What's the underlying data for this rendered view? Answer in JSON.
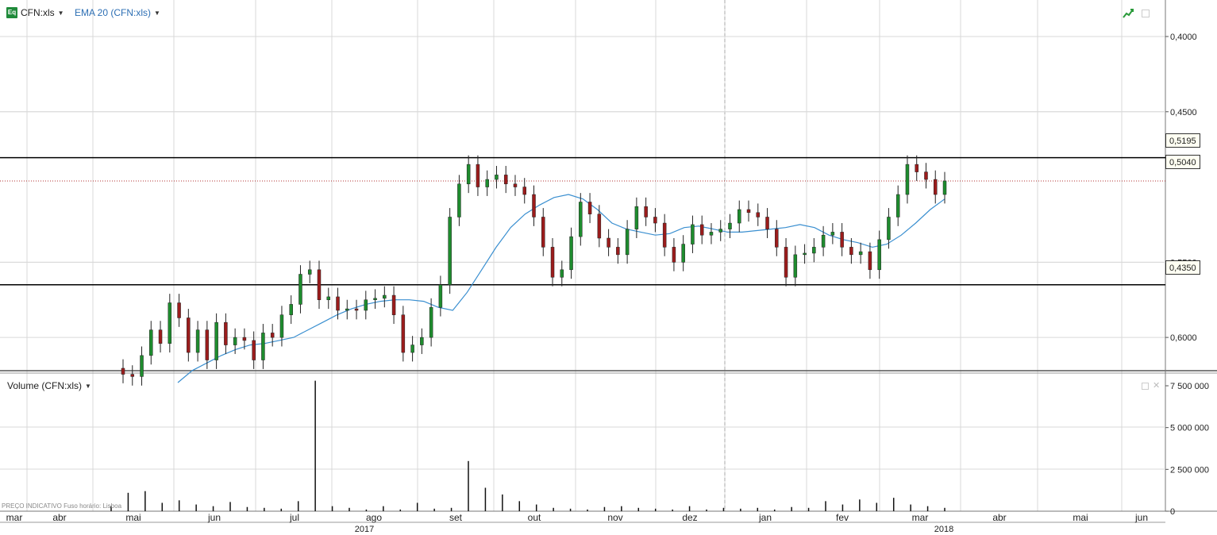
{
  "toolbar": {
    "symbol": "CFN:xls",
    "indicator": "EMA 20 (CFN:xls)"
  },
  "volume_panel": {
    "title": "Volume (CFN:xls)",
    "watermark": "PREÇO INDICATIVO    Fuso horário: Lisboa"
  },
  "price_boxes": {
    "upper": "0,5195",
    "current": "0,5040",
    "lower": "0,4350"
  },
  "colors": {
    "up": "#1e8c2e",
    "down": "#9b1c1c",
    "ema": "#3a8fd0",
    "grid": "#d9d9d9",
    "hline": "#000000",
    "current": "#b03030"
  },
  "chart_data": [
    {
      "type": "candlestick",
      "title": "CFN:xls",
      "y_ticks": [
        "0,4000",
        "0,4500",
        "0,5500",
        "0,6000"
      ],
      "ylim": [
        0.37,
        0.62
      ],
      "x_months": [
        "mar",
        "abr",
        "mai",
        "jun",
        "jul",
        "ago",
        "set",
        "out",
        "nov",
        "dez",
        "jan",
        "fev",
        "mar",
        "abr",
        "mai",
        "jun"
      ],
      "x_years": [
        "2017",
        "2018"
      ],
      "horizontal_lines": [
        0.5195,
        0.435
      ],
      "current_price": 0.504,
      "series": [
        {
          "name": "CFN:xls",
          "close": [
            0.3755,
            0.374,
            0.388,
            0.405,
            0.396,
            0.423,
            0.413,
            0.39,
            0.405,
            0.385,
            0.41,
            0.395,
            0.4,
            0.398,
            0.385,
            0.403,
            0.4,
            0.415,
            0.422,
            0.442,
            0.445,
            0.425,
            0.427,
            0.418,
            0.419,
            0.418,
            0.425,
            0.426,
            0.428,
            0.415,
            0.39,
            0.395,
            0.4,
            0.42,
            0.435,
            0.48,
            0.502,
            0.515,
            0.5,
            0.505,
            0.508,
            0.502,
            0.5,
            0.495,
            0.48,
            0.46,
            0.44,
            0.445,
            0.467,
            0.49,
            0.482,
            0.466,
            0.46,
            0.455,
            0.472,
            0.487,
            0.48,
            0.476,
            0.46,
            0.45,
            0.462,
            0.475,
            0.468,
            0.47,
            0.472,
            0.476,
            0.485,
            0.483,
            0.48,
            0.472,
            0.46,
            0.44,
            0.455,
            0.456,
            0.46,
            0.468,
            0.47,
            0.46,
            0.455,
            0.457,
            0.445,
            0.465,
            0.48,
            0.495,
            0.515,
            0.51,
            0.505,
            0.495,
            0.504
          ]
        },
        {
          "name": "EMA 20 (CFN:xls)",
          "values": [
            0.37,
            0.378,
            0.383,
            0.388,
            0.392,
            0.395,
            0.396,
            0.398,
            0.4,
            0.405,
            0.41,
            0.415,
            0.419,
            0.422,
            0.424,
            0.425,
            0.425,
            0.424,
            0.42,
            0.418,
            0.43,
            0.445,
            0.46,
            0.473,
            0.482,
            0.488,
            0.493,
            0.495,
            0.492,
            0.485,
            0.476,
            0.472,
            0.47,
            0.468,
            0.469,
            0.473,
            0.474,
            0.472,
            0.47,
            0.47,
            0.471,
            0.472,
            0.473,
            0.475,
            0.473,
            0.468,
            0.465,
            0.463,
            0.46,
            0.462,
            0.468,
            0.476,
            0.485,
            0.492
          ]
        }
      ]
    },
    {
      "type": "bar",
      "title": "Volume (CFN:xls)",
      "y_ticks": [
        "7 500 000",
        "5 000 000",
        "2 500 000",
        "0"
      ],
      "ylim": [
        0,
        7500000
      ],
      "values": [
        300000,
        1100000,
        1200000,
        500000,
        650000,
        400000,
        300000,
        550000,
        250000,
        200000,
        150000,
        600000,
        7800000,
        300000,
        200000,
        100000,
        300000,
        100000,
        500000,
        150000,
        200000,
        3000000,
        1400000,
        1000000,
        600000,
        400000,
        200000,
        150000,
        100000,
        250000,
        300000,
        200000,
        150000,
        100000,
        300000,
        100000,
        200000,
        150000,
        200000,
        100000,
        250000,
        200000,
        600000,
        400000,
        700000,
        500000,
        800000,
        400000,
        300000,
        200000
      ]
    }
  ]
}
